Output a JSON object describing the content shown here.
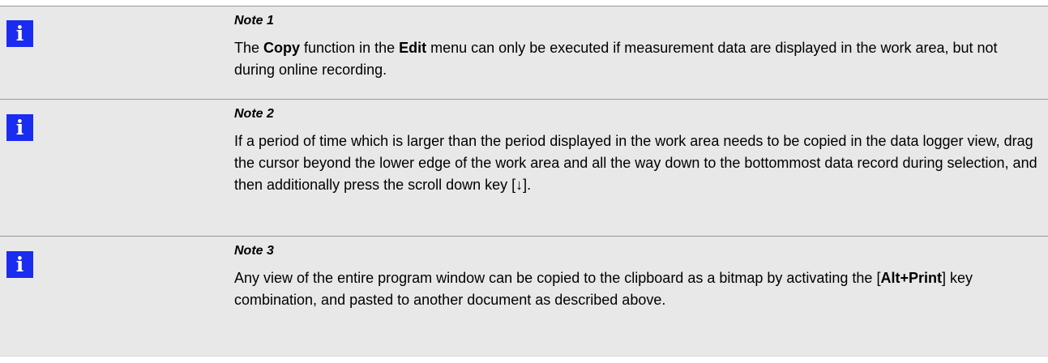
{
  "notes": [
    {
      "icon": "info-icon",
      "title": "Note 1",
      "parts": {
        "p1": "The ",
        "b1": "Copy",
        "p2": " function in the ",
        "b2": "Edit",
        "p3": " menu can only be executed if measurement data are displayed in the work area, but not during online recording."
      }
    },
    {
      "icon": "info-icon",
      "title": "Note 2",
      "text": "If a period of time which is larger than the period displayed in the work area needs to be copied in the data logger view, drag the cursor beyond the lower edge of the work area and all the way down to the bottommost data record during selection, and then additionally press the scroll down key [↓]."
    },
    {
      "icon": "info-icon",
      "title": "Note 3",
      "parts": {
        "p1": "Any view of the entire program window can be copied to the clipboard as a bitmap by activating the [",
        "b1": "Alt+Print",
        "p2": "] key combination, and pasted to another document as described above."
      }
    }
  ],
  "icon_glyph": "i",
  "colors": {
    "icon_background": "#1a2cf0",
    "row_background": "#e8e8e8",
    "divider": "#9a9a9a"
  }
}
